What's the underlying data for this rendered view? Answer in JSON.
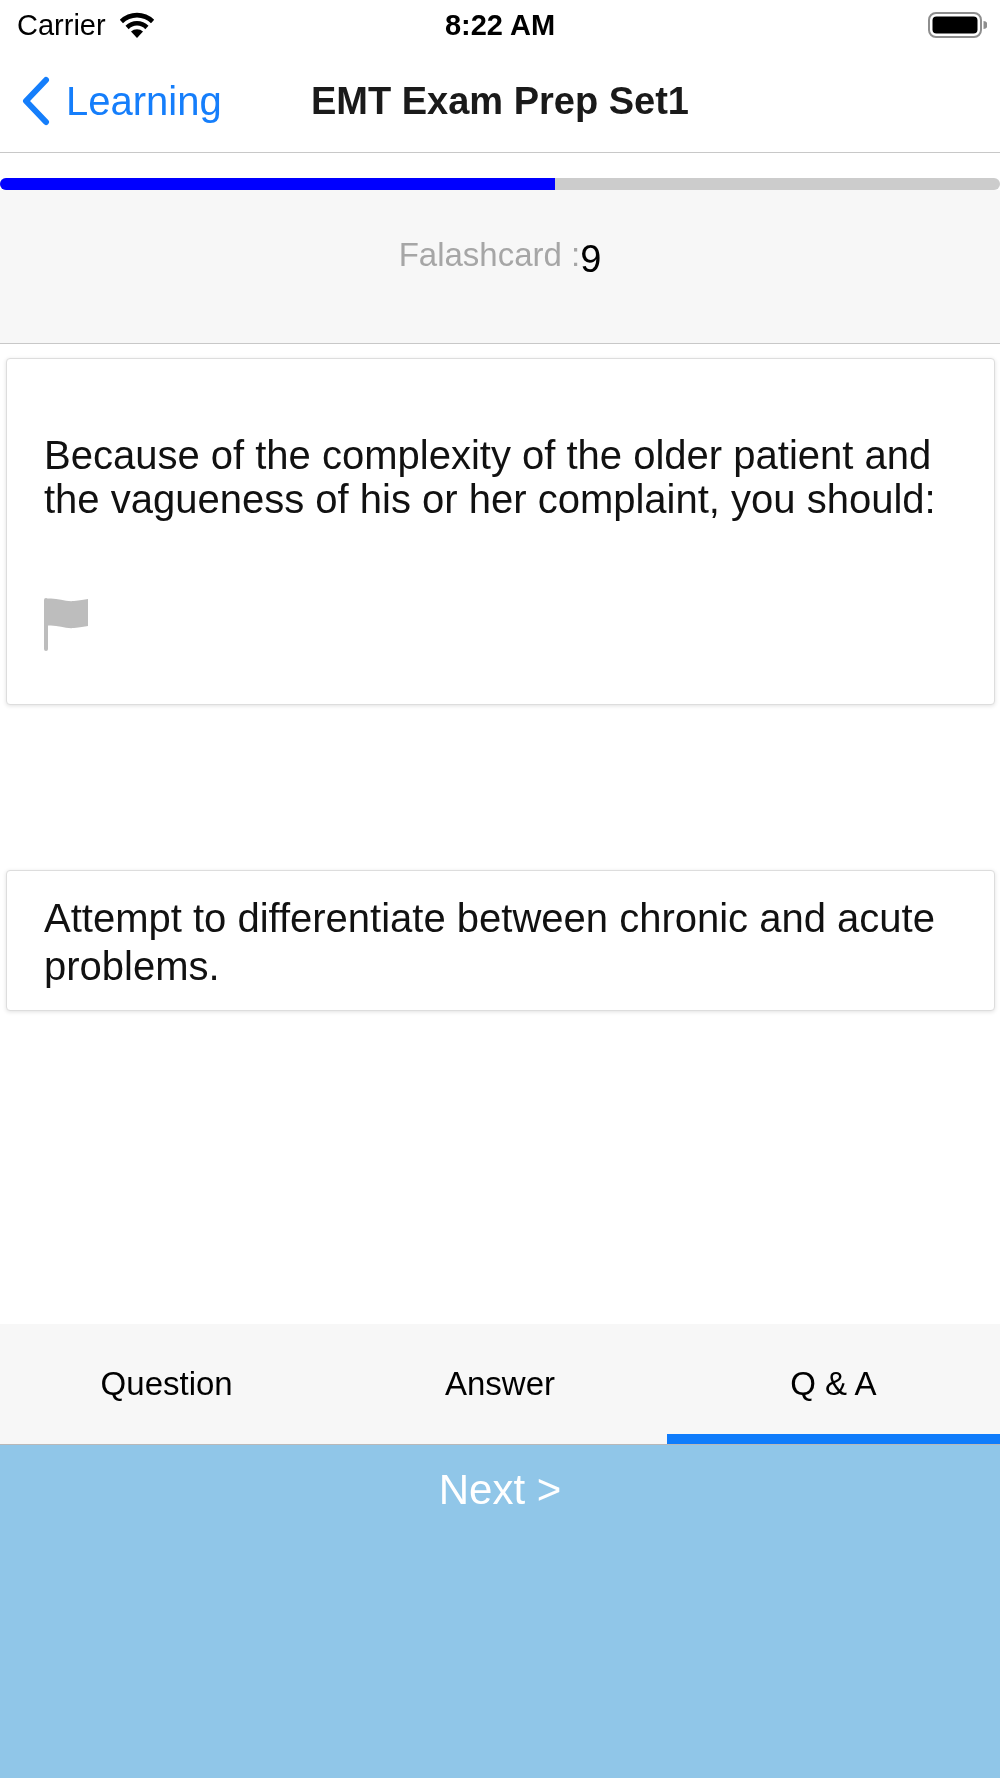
{
  "status_bar": {
    "carrier": "Carrier",
    "time": "8:22 AM"
  },
  "nav_bar": {
    "back_label": "Learning",
    "title": "EMT Exam Prep Set1"
  },
  "progress": {
    "level": 0.555
  },
  "card_counter": {
    "label": "Falashcard :",
    "number": "9"
  },
  "question": {
    "text": "Because of the complexity of the older patient and the vagueness of his or her complaint, you should:",
    "flagged": false
  },
  "answer": {
    "text": "Attempt to differentiate between chronic and acute problems."
  },
  "tabs": [
    {
      "label": "Question",
      "selected": false
    },
    {
      "label": "Answer",
      "selected": false
    },
    {
      "label": "Q & A",
      "selected": true
    }
  ],
  "next_button": {
    "label": "Next >"
  }
}
